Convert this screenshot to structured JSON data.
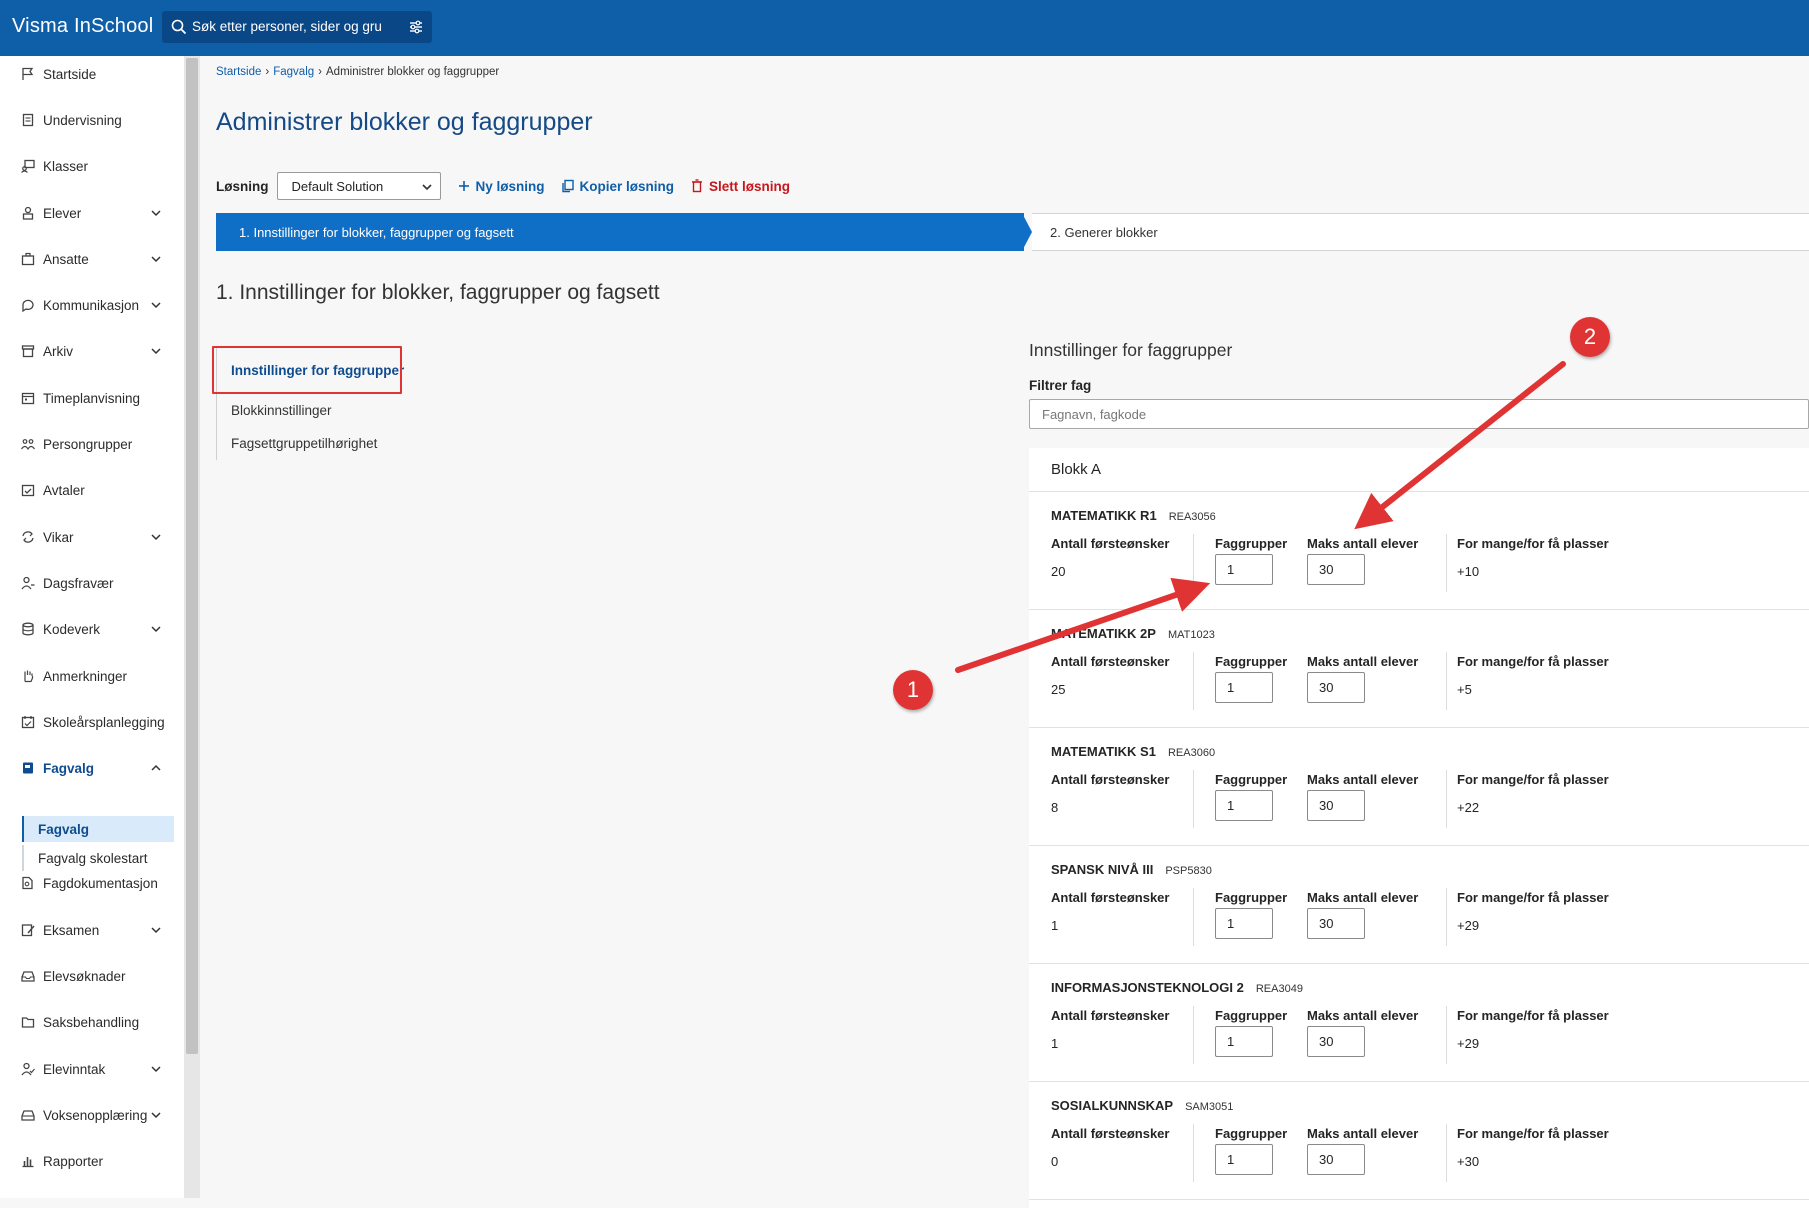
{
  "app": {
    "title": "Visma InSchool"
  },
  "search": {
    "placeholder": "Søk etter personer, sider og gru"
  },
  "sidebar": {
    "items": [
      {
        "label": "Startside",
        "icon": "flag-icon"
      },
      {
        "label": "Undervisning",
        "icon": "document-icon"
      },
      {
        "label": "Klasser",
        "icon": "classroom-icon"
      },
      {
        "label": "Elever",
        "icon": "students-icon",
        "expandable": true
      },
      {
        "label": "Ansatte",
        "icon": "briefcase-icon",
        "expandable": true
      },
      {
        "label": "Kommunikasjon",
        "icon": "chat-icon",
        "expandable": true
      },
      {
        "label": "Arkiv",
        "icon": "archive-icon",
        "expandable": true
      },
      {
        "label": "Timeplanvisning",
        "icon": "calendar-icon"
      },
      {
        "label": "Persongrupper",
        "icon": "people-icon"
      },
      {
        "label": "Avtaler",
        "icon": "calendar-check-icon"
      },
      {
        "label": "Vikar",
        "icon": "swap-icon",
        "expandable": true
      },
      {
        "label": "Dagsfravær",
        "icon": "person-absence-icon"
      },
      {
        "label": "Kodeverk",
        "icon": "database-icon",
        "expandable": true
      },
      {
        "label": "Anmerkninger",
        "icon": "hand-icon"
      },
      {
        "label": "Skoleårsplanlegging",
        "icon": "planner-icon"
      },
      {
        "label": "Fagvalg",
        "icon": "book-icon",
        "expandable": true,
        "expanded": true
      },
      {
        "label": "Fagdokumentasjon",
        "icon": "doc-search-icon"
      },
      {
        "label": "Eksamen",
        "icon": "exam-icon",
        "expandable": true
      },
      {
        "label": "Elevsøknader",
        "icon": "inbox-icon"
      },
      {
        "label": "Saksbehandling",
        "icon": "folder-icon"
      },
      {
        "label": "Elevinntak",
        "icon": "person-check-icon",
        "expandable": true
      },
      {
        "label": "Voksenopplæring",
        "icon": "tray-icon",
        "expandable": true
      },
      {
        "label": "Rapporter",
        "icon": "bar-chart-icon"
      }
    ],
    "fagvalg_sub": [
      "Fagvalg",
      "Fagvalg skolestart"
    ]
  },
  "breadcrumb": [
    "Startside",
    "Fagvalg",
    "Administrer blokker og faggrupper"
  ],
  "page_title": "Administrer blokker og faggrupper",
  "toolbar": {
    "label": "Løsning",
    "selected_solution": "Default Solution",
    "new_label": "Ny løsning",
    "copy_label": "Kopier løsning",
    "delete_label": "Slett løsning"
  },
  "steps": [
    "1. Innstillinger for blokker, faggrupper og fagsett",
    "2. Generer blokker"
  ],
  "section_title": "1. Innstillinger for blokker, faggrupper og fagsett",
  "subnav": [
    "Innstillinger for faggrupper",
    "Blokkinnstillinger",
    "Fagsettgruppetilhørighet"
  ],
  "panel": {
    "title": "Innstillinger for faggrupper",
    "filter_label": "Filtrer fag",
    "filter_placeholder": "Fagnavn, fagkode",
    "block_name": "Blokk A",
    "columns": [
      "Antall førsteønsker",
      "Faggrupper",
      "Maks antall elever",
      "For mange/for få plasser"
    ],
    "subjects": [
      {
        "name": "MATEMATIKK R1",
        "code": "REA3056",
        "first_choices": "20",
        "groups": "1",
        "max": "30",
        "diff": "+10"
      },
      {
        "name": "MATEMATIKK 2P",
        "code": "MAT1023",
        "first_choices": "25",
        "groups": "1",
        "max": "30",
        "diff": "+5"
      },
      {
        "name": "MATEMATIKK S1",
        "code": "REA3060",
        "first_choices": "8",
        "groups": "1",
        "max": "30",
        "diff": "+22"
      },
      {
        "name": "SPANSK NIVÅ III",
        "code": "PSP5830",
        "first_choices": "1",
        "groups": "1",
        "max": "30",
        "diff": "+29"
      },
      {
        "name": "INFORMASJONSTEKNOLOGI 2",
        "code": "REA3049",
        "first_choices": "1",
        "groups": "1",
        "max": "30",
        "diff": "+29"
      },
      {
        "name": "SOSIALKUNNSKAP",
        "code": "SAM3051",
        "first_choices": "0",
        "groups": "1",
        "max": "30",
        "diff": "+30"
      }
    ]
  },
  "annotations": [
    "1",
    "2"
  ],
  "colors": {
    "brand": "#0f5ea8",
    "step_active": "#0f6fc6",
    "danger": "#c8161d",
    "annotation": "#e03434"
  }
}
